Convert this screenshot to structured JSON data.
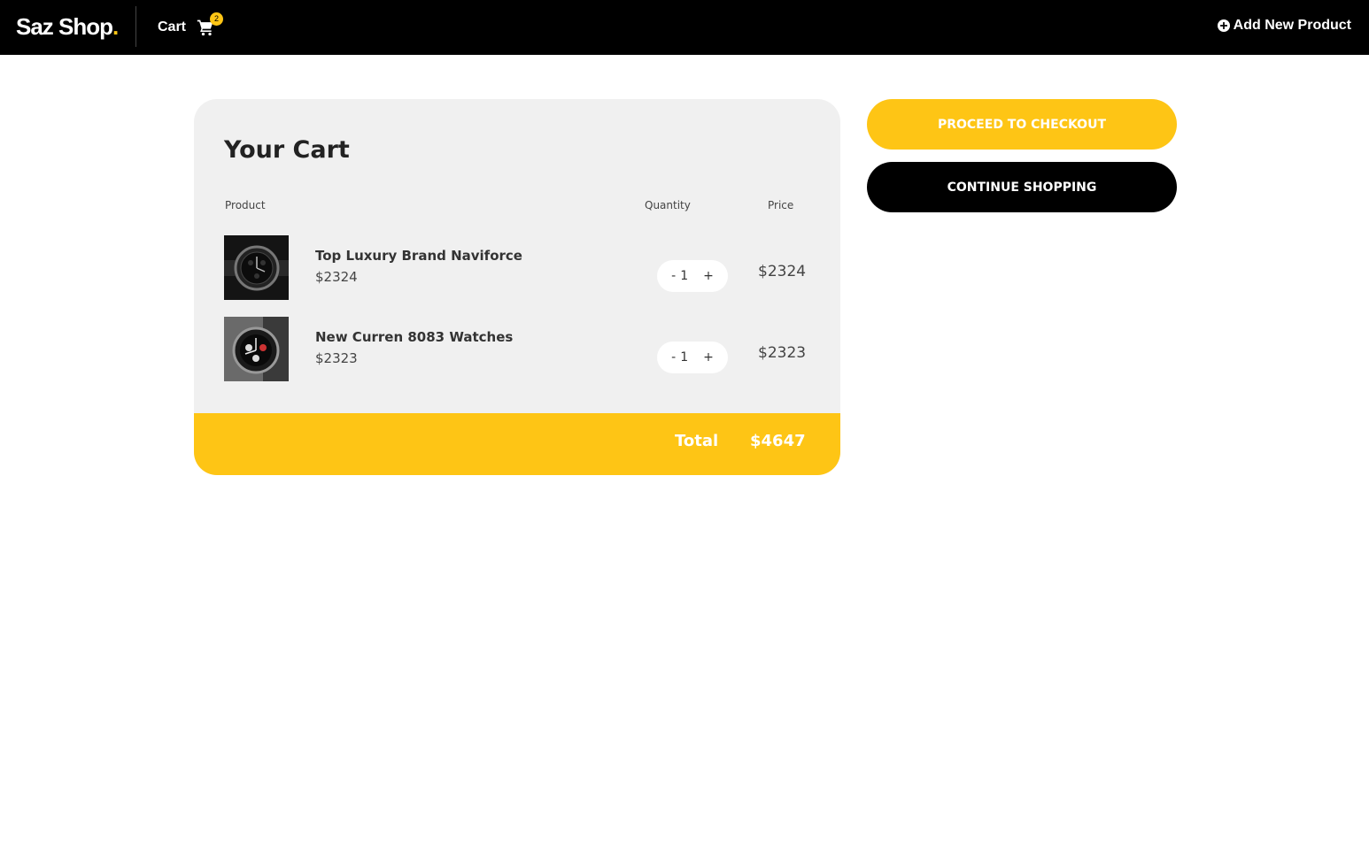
{
  "navbar": {
    "logo": "Saz Shop",
    "logo_dot": ".",
    "cart_label": "Cart",
    "cart_count": "2",
    "add_product_label": "Add New Product"
  },
  "cart": {
    "title": "Your Cart",
    "columns": {
      "product": "Product",
      "quantity": "Quantity",
      "price": "Price"
    },
    "items": [
      {
        "name": "Top Luxury Brand Naviforce",
        "unit_price": "$2324",
        "quantity": "1",
        "price": "$2324",
        "image_icon": "watch-image"
      },
      {
        "name": "New Curren 8083 Watches",
        "unit_price": "$2323",
        "quantity": "1",
        "price": "$2323",
        "image_icon": "watch-image"
      }
    ],
    "qty_minus": "-",
    "qty_plus": "+",
    "total_label": "Total",
    "total_value": "$4647"
  },
  "actions": {
    "checkout_label": "PROCEED TO CHECKOUT",
    "continue_label": "CONTINUE SHOPPING"
  },
  "colors": {
    "accent": "#fec515",
    "navbar_bg": "#000000",
    "card_bg": "#f0f0f0"
  }
}
